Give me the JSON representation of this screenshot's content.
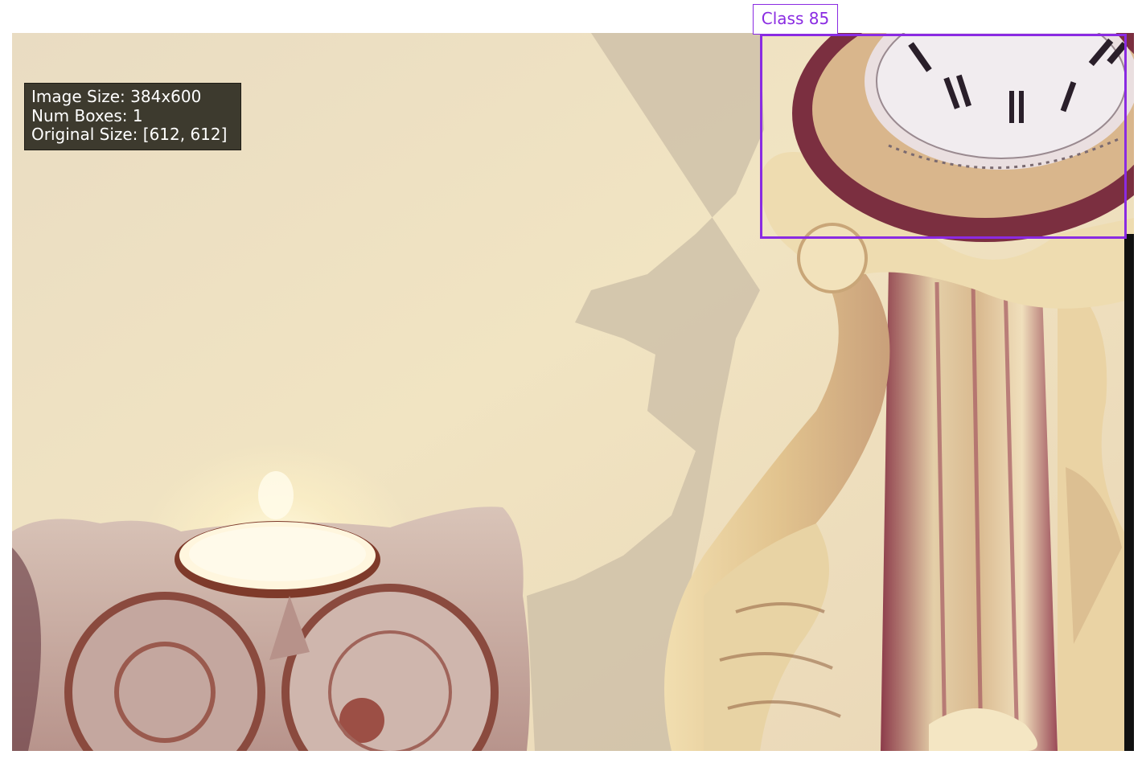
{
  "info": {
    "image_size": "Image Size: 384x600",
    "num_boxes": "Num Boxes: 1",
    "original_size": "Original Size: [612, 612]"
  },
  "detections": [
    {
      "label": "Class 85",
      "color": "#8a2be2"
    }
  ],
  "scene": {
    "objects": [
      "owl-shaped tealight candle holder",
      "ornate cream mantel clock with roman numerals",
      "shadow on wall"
    ],
    "palette": {
      "wall": "#efe3c4",
      "clock_wood": "#e6cf9e",
      "clock_dark": "#7a2f3c",
      "owl": "#cbb3aa"
    }
  }
}
